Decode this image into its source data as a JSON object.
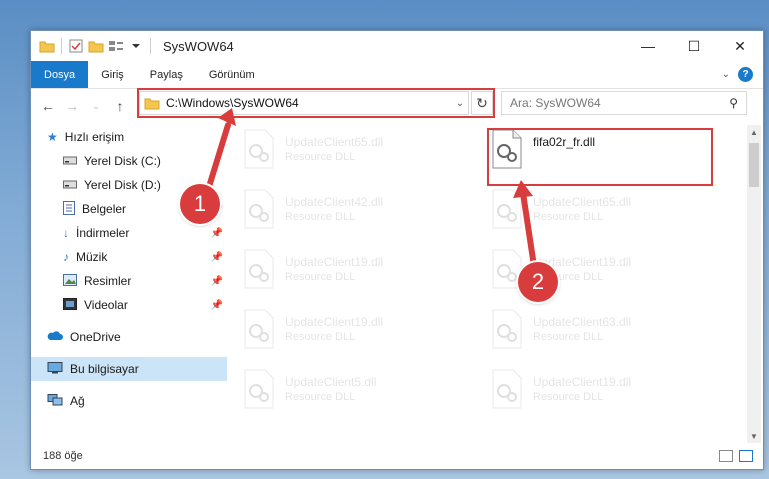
{
  "window": {
    "title": "SysWOW64"
  },
  "ribbon": {
    "tabs": [
      "Dosya",
      "Giriş",
      "Paylaş",
      "Görünüm"
    ]
  },
  "address": {
    "path": "C:\\Windows\\SysWOW64"
  },
  "search": {
    "placeholder": "Ara: SysWOW64"
  },
  "sidebar": {
    "items": [
      {
        "label": "Hızlı erişim",
        "icon": "star-icon"
      },
      {
        "label": "Yerel Disk (C:)",
        "icon": "drive-icon"
      },
      {
        "label": "Yerel Disk (D:)",
        "icon": "drive-icon"
      },
      {
        "label": "Belgeler",
        "icon": "document-icon"
      },
      {
        "label": "İndirmeler",
        "icon": "download-icon"
      },
      {
        "label": "Müzik",
        "icon": "music-icon"
      },
      {
        "label": "Resimler",
        "icon": "pictures-icon"
      },
      {
        "label": "Videolar",
        "icon": "video-icon"
      },
      {
        "label": "OneDrive",
        "icon": "cloud-icon"
      },
      {
        "label": "Bu bilgisayar",
        "icon": "computer-icon"
      },
      {
        "label": "Ağ",
        "icon": "network-icon"
      }
    ]
  },
  "files": {
    "highlighted": {
      "name": "fifa02r_fr.dll",
      "type": ""
    },
    "left_column": [
      {
        "name": "UpdateClient65.dll",
        "type": "Resource DLL"
      },
      {
        "name": "UpdateClient42.dll",
        "type": "Resource DLL"
      },
      {
        "name": "UpdateClient19.dll",
        "type": "Resource DLL"
      },
      {
        "name": "UpdateClient19.dll",
        "type": "Resource DLL"
      },
      {
        "name": "UpdateClient5.dll",
        "type": "Resource DLL"
      }
    ],
    "right_column": [
      {
        "name": "UpdateClient65.dll",
        "type": "Resource DLL"
      },
      {
        "name": "UpdateClient19.dll",
        "type": "Resource DLL"
      },
      {
        "name": "UpdateClient63.dll",
        "type": "Resource DLL"
      },
      {
        "name": "UpdateClient19.dll",
        "type": "Resource DLL"
      }
    ]
  },
  "status": {
    "count": "188 öğe"
  },
  "annotations": {
    "step1": "1",
    "step2": "2"
  },
  "colors": {
    "accent": "#1979ca",
    "highlight": "#d93c3c",
    "selected": "#cce4f7"
  }
}
